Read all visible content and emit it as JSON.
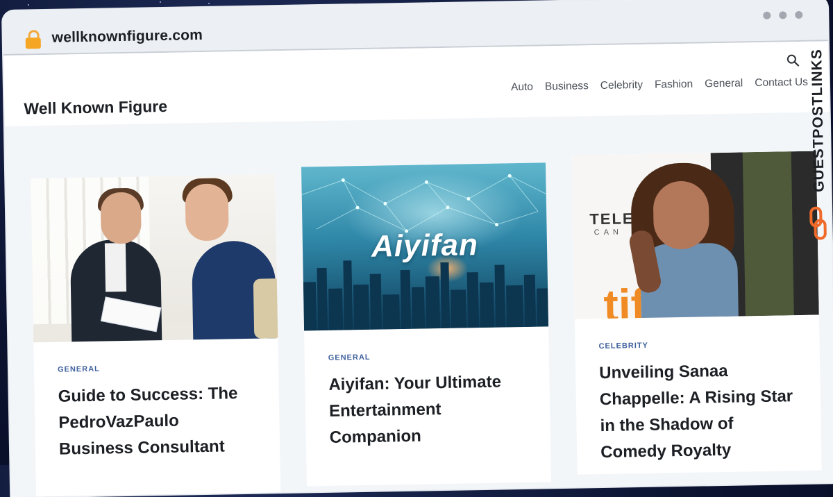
{
  "browser": {
    "url": "wellknownfigure.com"
  },
  "site": {
    "brand": "Well Known Figure",
    "nav": [
      {
        "label": "Auto"
      },
      {
        "label": "Business"
      },
      {
        "label": "Celebrity"
      },
      {
        "label": "Fashion"
      },
      {
        "label": "General"
      },
      {
        "label": "Contact Us"
      }
    ]
  },
  "posts": [
    {
      "category": "GENERAL",
      "title": "Guide to Success: The PedroVazPaulo Business Consultant"
    },
    {
      "category": "GENERAL",
      "title": "Aiyifan: Your Ultimate Entertainment Companion",
      "image_text": "Aiyifan"
    },
    {
      "category": "CELEBRITY",
      "title": "Unveiling Sanaa Chappelle: A Rising Star in the Shadow of Comedy Royalty",
      "image_text_1": "TELE",
      "image_text_2": "CAN",
      "image_text_3": "tif"
    }
  ],
  "watermark": {
    "text": "GUESTPOSTLINKS"
  },
  "colors": {
    "category": "#3d5f9b",
    "accent_orange": "#f06a2a",
    "page_bg": "#f3f6f9"
  }
}
